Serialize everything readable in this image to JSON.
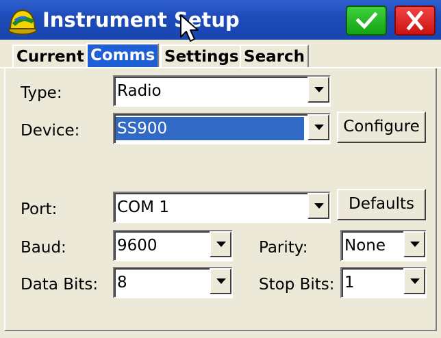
{
  "window": {
    "title": "Instrument Setup"
  },
  "tabs": [
    {
      "label": "Current",
      "active": false
    },
    {
      "label": "Comms",
      "active": true
    },
    {
      "label": "Settings",
      "active": false
    },
    {
      "label": "Search",
      "active": false
    }
  ],
  "form": {
    "type": {
      "label": "Type:",
      "value": "Radio"
    },
    "device": {
      "label": "Device:",
      "value": "SS900"
    },
    "port": {
      "label": "Port:",
      "value": "COM 1"
    },
    "baud": {
      "label": "Baud:",
      "value": "9600"
    },
    "parity": {
      "label": "Parity:",
      "value": "None"
    },
    "data_bits": {
      "label": "Data Bits:",
      "value": "8"
    },
    "stop_bits": {
      "label": "Stop Bits:",
      "value": "1"
    }
  },
  "buttons": {
    "configure": "Configure",
    "defaults": "Defaults"
  },
  "colors": {
    "titlebar": "#1e4ab8",
    "active_tab": "#1f5fd6",
    "selection": "#316ac5",
    "ok": "#13a313",
    "close": "#cc1212"
  },
  "icons": {
    "app": "hard-hat-icon",
    "ok": "checkmark-icon",
    "close": "close-icon",
    "cursor": "mouse-pointer-icon"
  }
}
